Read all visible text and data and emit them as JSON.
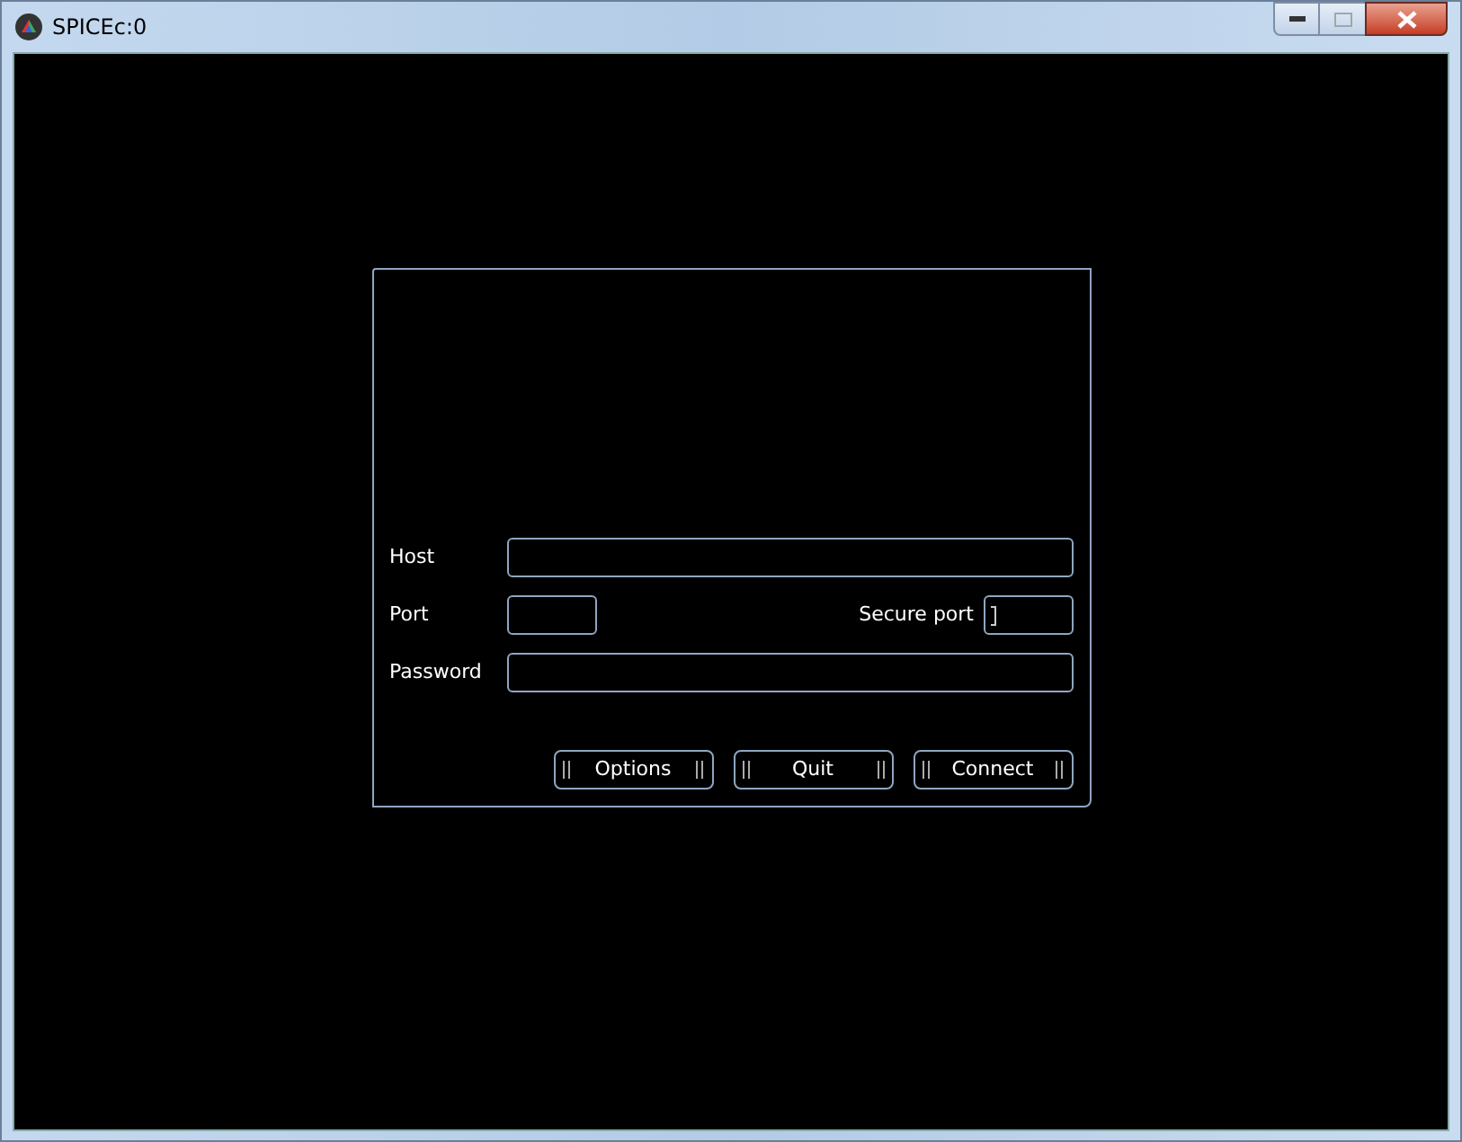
{
  "window": {
    "title": "SPICEc:0"
  },
  "dialog": {
    "fields": [
      {
        "label": "Host",
        "kind": "wide",
        "focused": false
      },
      {
        "label": "Port",
        "kind": "short",
        "focused": false
      },
      {
        "label": "Secure port",
        "kind": "short",
        "focused": true
      },
      {
        "label": "Password",
        "kind": "wide",
        "focused": false
      }
    ],
    "buttons": [
      "Options",
      "Quit",
      "Connect"
    ]
  }
}
